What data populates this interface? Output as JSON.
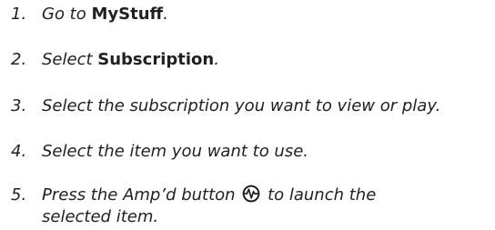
{
  "steps": [
    {
      "number": "1.",
      "prefix": "Go to ",
      "bold": "MyStuff",
      "suffix": "."
    },
    {
      "number": "2.",
      "prefix": "Select ",
      "bold": "Subscription",
      "suffix": "."
    },
    {
      "number": "3.",
      "text": "Select the subscription you want to view or play."
    },
    {
      "number": "4.",
      "text": "Select the item you want to use."
    },
    {
      "number": "5.",
      "prefix": "Press the Amp’d button",
      "icon": "ampd-button-icon",
      "suffix": "to launch the",
      "line2": "selected item."
    }
  ],
  "colors": {
    "text": "#231f20"
  }
}
